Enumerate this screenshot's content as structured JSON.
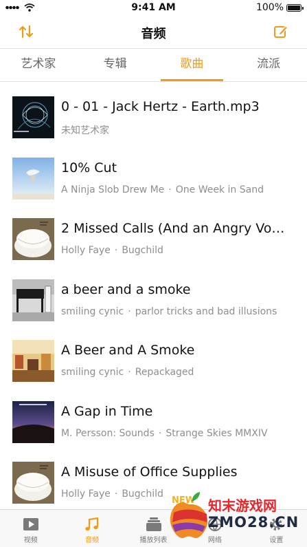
{
  "status_bar": {
    "time": "9:41 AM",
    "battery": "100%"
  },
  "nav": {
    "title": "音频",
    "sort_icon": "sort-arrows-icon",
    "edit_icon": "edit-icon"
  },
  "tabs": [
    {
      "label": "艺术家",
      "active": false
    },
    {
      "label": "专辑",
      "active": false
    },
    {
      "label": "歌曲",
      "active": true
    },
    {
      "label": "流派",
      "active": false
    }
  ],
  "songs": [
    {
      "title": "0 - 01 - Jack Hertz - Earth.mp3",
      "artist": "未知艺术家",
      "album": ""
    },
    {
      "title": "10% Cut",
      "artist": "A Ninja Slob Drew Me",
      "album": "One Week in Sand"
    },
    {
      "title": "2 Missed Calls (And an Angry Voi...",
      "artist": "Holly Faye",
      "album": "Bugchild"
    },
    {
      "title": "a beer and a smoke",
      "artist": "smiling cynic",
      "album": "parlor tricks and bad illusions"
    },
    {
      "title": "A Beer and A Smoke",
      "artist": "smiling cynic",
      "album": "Repackaged"
    },
    {
      "title": "A Gap in Time",
      "artist": "M. Persson: Sounds",
      "album": "Strange Skies MMXIV"
    },
    {
      "title": "A Misuse of Office Supplies",
      "artist": "Holly Faye",
      "album": "Bugchild"
    }
  ],
  "separator": "·",
  "tabbar": [
    {
      "label": "视频",
      "icon": "video-play-icon",
      "active": false
    },
    {
      "label": "音频",
      "icon": "music-note-icon",
      "active": true
    },
    {
      "label": "播放列表",
      "icon": "playlist-icon",
      "active": false
    },
    {
      "label": "网络",
      "icon": "network-icon",
      "active": false
    },
    {
      "label": "设置",
      "icon": "gear-icon",
      "active": false
    }
  ],
  "watermark": {
    "new_badge": "NEW",
    "site_name": "知末游戏网",
    "site_url": "ZMO28.CN"
  },
  "colors": {
    "accent": "#f39a14",
    "secondary_text": "#8e8e8e"
  }
}
